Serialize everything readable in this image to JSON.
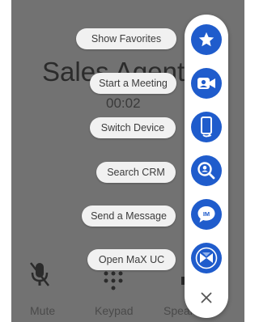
{
  "call": {
    "title": "Sales Agent",
    "timer": "00:02"
  },
  "controls": {
    "mute_label": "Mute",
    "keypad_label": "Keypad",
    "speaker_label": "Speaker"
  },
  "menu": {
    "items": [
      {
        "label": "Show Favorites",
        "icon": "star-icon"
      },
      {
        "label": "Start a Meeting",
        "icon": "meeting-icon"
      },
      {
        "label": "Switch Device",
        "icon": "switch-device-icon"
      },
      {
        "label": "Search CRM",
        "icon": "search-crm-icon"
      },
      {
        "label": "Send a Message",
        "icon": "im-message-icon"
      },
      {
        "label": "Open MaX UC",
        "icon": "max-uc-icon"
      }
    ],
    "close_icon": "close-icon"
  },
  "colors": {
    "accent": "#1f5ccc",
    "overlay": "#727272",
    "pill_bg": "#f1f1f1"
  }
}
